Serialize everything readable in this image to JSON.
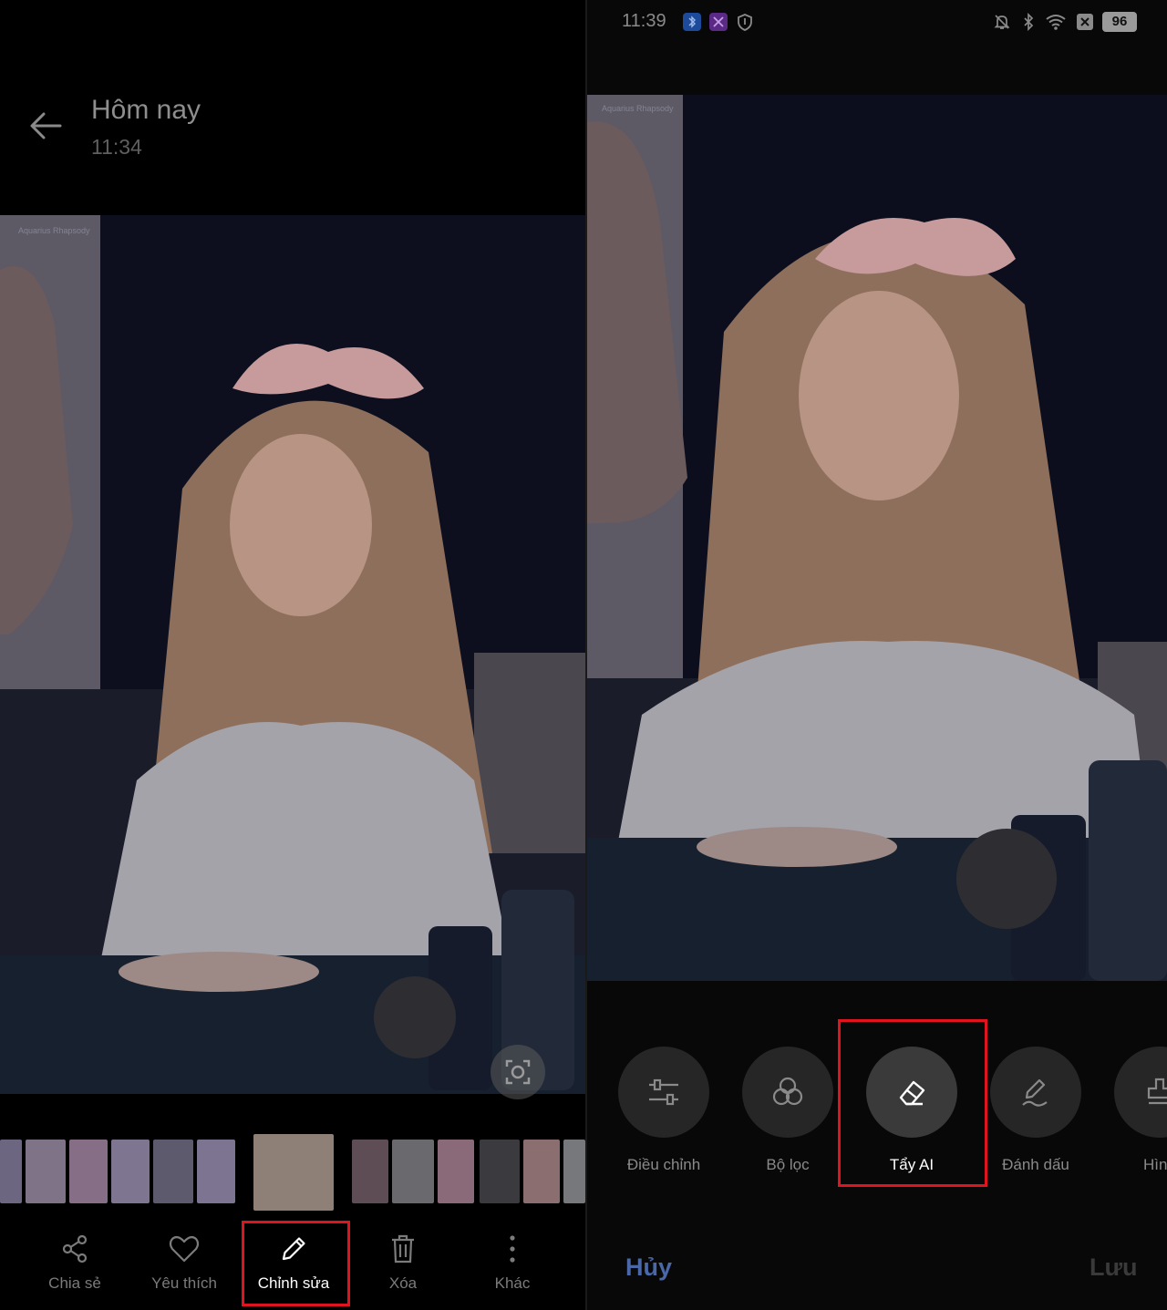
{
  "left": {
    "header": {
      "title": "Hôm nay",
      "time": "11:34"
    },
    "watermark": "Aquarius Rhapsody",
    "bottom_nav": [
      {
        "label": "Chia sẻ",
        "icon": "share-icon"
      },
      {
        "label": "Yêu thích",
        "icon": "heart-icon"
      },
      {
        "label": "Chỉnh sửa",
        "icon": "pencil-icon",
        "highlighted": true
      },
      {
        "label": "Xóa",
        "icon": "trash-icon"
      },
      {
        "label": "Khác",
        "icon": "more-vertical-icon"
      }
    ]
  },
  "right": {
    "status_bar": {
      "time": "11:39",
      "battery": "96"
    },
    "watermark": "Aquarius Rhapsody",
    "tools": [
      {
        "label": "Điều chỉnh",
        "icon": "sliders-icon"
      },
      {
        "label": "Bộ lọc",
        "icon": "filter-circles-icon"
      },
      {
        "label": "Tẩy AI",
        "icon": "eraser-icon",
        "highlighted": true
      },
      {
        "label": "Đánh dấu",
        "icon": "markup-pen-icon"
      },
      {
        "label": "Hình",
        "icon": "stamp-icon"
      }
    ],
    "cancel_label": "Hủy",
    "save_label": "Lưu"
  },
  "colors": {
    "highlight_box": "#e0141e",
    "cancel_text": "#4a67a8"
  }
}
